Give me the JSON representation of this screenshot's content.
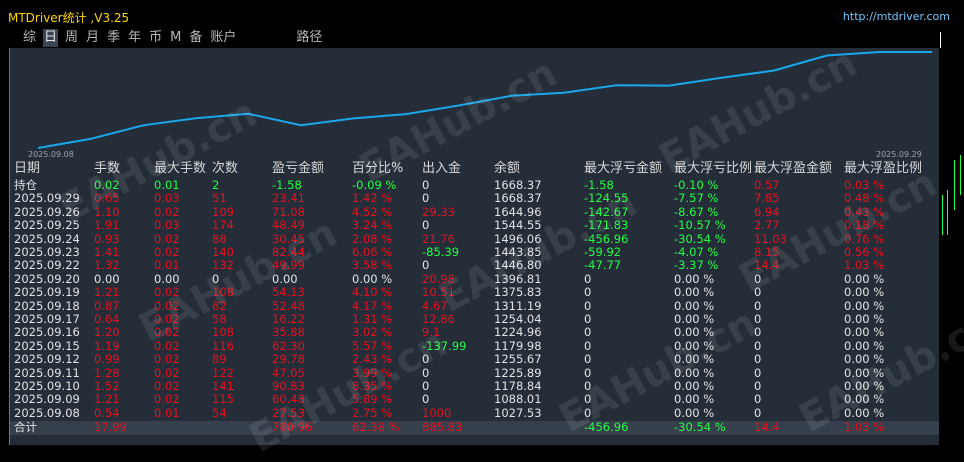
{
  "app": {
    "title": "MTDriver统计 ,V3.25",
    "url": "http://mtdriver.com"
  },
  "tabs": [
    "综",
    "日",
    "周",
    "月",
    "季",
    "年",
    "币",
    "M",
    "备",
    "账户",
    "路径"
  ],
  "active_tab": 1,
  "chart_data": {
    "type": "line",
    "x_start_label": "2025.09.08",
    "x_end_label": "2025.09.29",
    "values": [
      1027.53,
      1088.01,
      1178.84,
      1225.89,
      1255.67,
      1179.98,
      1224.96,
      1254.04,
      1311.19,
      1375.83,
      1396.81,
      1446.8,
      1443.85,
      1496.06,
      1544.55,
      1644.96,
      1668.37,
      1668.37
    ],
    "color": "#1aa7ea",
    "line_color": "#1aa7ea"
  },
  "table": {
    "headers": [
      "日期",
      "手数",
      "最大手数",
      "次数",
      "盈亏金额",
      "百分比%",
      "出入金",
      "余额",
      "最大浮亏金额",
      "最大浮亏比例",
      "最大浮盈金额",
      "最大浮盈比例"
    ],
    "rows": [
      [
        "持仓",
        "0.02",
        "0.01",
        "2",
        "-1.58",
        "-0.09 %",
        "0",
        "1668.37",
        "-1.58",
        "-0.10 %",
        "0.57",
        "0.03 %"
      ],
      [
        "2025.09.29",
        "0.65",
        "0.03",
        "51",
        "23.41",
        "1.42 %",
        "0",
        "1668.37",
        "-124.55",
        "-7.57 %",
        "7.85",
        "0.48 %"
      ],
      [
        "2025.09.26",
        "1.10",
        "0.02",
        "109",
        "71.08",
        "4.52 %",
        "29.33",
        "1644.96",
        "-142.67",
        "-8.67 %",
        "6.94",
        "0.43 %"
      ],
      [
        "2025.09.25",
        "1.91",
        "0.03",
        "174",
        "48.49",
        "3.24 %",
        "0",
        "1544.55",
        "-171.83",
        "-10.57 %",
        "2.77",
        "0.18 %"
      ],
      [
        "2025.09.24",
        "0.93",
        "0.02",
        "88",
        "30.45",
        "2.08 %",
        "21.76",
        "1496.06",
        "-456.96",
        "-30.54 %",
        "11.03",
        "0.76 %"
      ],
      [
        "2025.09.23",
        "1.41",
        "0.02",
        "140",
        "82.44",
        "6.06 %",
        "-85.39",
        "1443.85",
        "-59.92",
        "-4.07 %",
        "8.15",
        "0.56 %"
      ],
      [
        "2025.09.22",
        "1.32",
        "0.01",
        "132",
        "49.99",
        "3.58 %",
        "0",
        "1446.80",
        "-47.77",
        "-3.37 %",
        "14.4",
        "1.03 %"
      ],
      [
        "2025.09.20",
        "0.00",
        "0.00",
        "0",
        "0.00",
        "0.00 %",
        "20.98",
        "1396.81",
        "0",
        "0.00 %",
        "0",
        "0.00 %"
      ],
      [
        "2025.09.19",
        "1.21",
        "0.02",
        "108",
        "54.13",
        "4.10 %",
        "10.51",
        "1375.83",
        "0",
        "0.00 %",
        "0",
        "0.00 %"
      ],
      [
        "2025.09.18",
        "0.87",
        "0.02",
        "82",
        "52.48",
        "4.17 %",
        "4.67",
        "1311.19",
        "0",
        "0.00 %",
        "0",
        "0.00 %"
      ],
      [
        "2025.09.17",
        "0.64",
        "0.02",
        "58",
        "16.22",
        "1.31 %",
        "12.86",
        "1254.04",
        "0",
        "0.00 %",
        "0",
        "0.00 %"
      ],
      [
        "2025.09.16",
        "1.20",
        "0.02",
        "108",
        "35.88",
        "3.02 %",
        "9.1",
        "1224.96",
        "0",
        "0.00 %",
        "0",
        "0.00 %"
      ],
      [
        "2025.09.15",
        "1.19",
        "0.02",
        "116",
        "62.30",
        "5.57 %",
        "-137.99",
        "1179.98",
        "0",
        "0.00 %",
        "0",
        "0.00 %"
      ],
      [
        "2025.09.12",
        "0.99",
        "0.02",
        "89",
        "29.78",
        "2.43 %",
        "0",
        "1255.67",
        "0",
        "0.00 %",
        "0",
        "0.00 %"
      ],
      [
        "2025.09.11",
        "1.28",
        "0.02",
        "122",
        "47.05",
        "3.99 %",
        "0",
        "1225.89",
        "0",
        "0.00 %",
        "0",
        "0.00 %"
      ],
      [
        "2025.09.10",
        "1.52",
        "0.02",
        "141",
        "90.83",
        "8.35 %",
        "0",
        "1178.84",
        "0",
        "0.00 %",
        "0",
        "0.00 %"
      ],
      [
        "2025.09.09",
        "1.21",
        "0.02",
        "115",
        "60.48",
        "5.89 %",
        "0",
        "1088.01",
        "0",
        "0.00 %",
        "0",
        "0.00 %"
      ],
      [
        "2025.09.08",
        "0.54",
        "0.01",
        "54",
        "27.53",
        "2.75 %",
        "1000",
        "1027.53",
        "0",
        "0.00 %",
        "0",
        "0.00 %"
      ]
    ],
    "total": [
      "合计",
      "17.99",
      "",
      "",
      "780.96",
      "62.38 %",
      "885.83",
      "",
      "-456.96",
      "-30.54 %",
      "14.4",
      "1.03 %"
    ]
  },
  "watermarks": [
    "EAHub.cn",
    "EAHub.cn",
    "EAHub.cn",
    "EAHub.cn",
    "EAHub.cn",
    "EAHub.cn",
    "EAHub.cn",
    "EAHub.cn",
    "EAHub.cn"
  ],
  "colors": {
    "red": "#e8101e",
    "green": "#22ff44",
    "white": "#e4e4e4",
    "header": "#d8d8d8",
    "panel": "#242d38"
  }
}
